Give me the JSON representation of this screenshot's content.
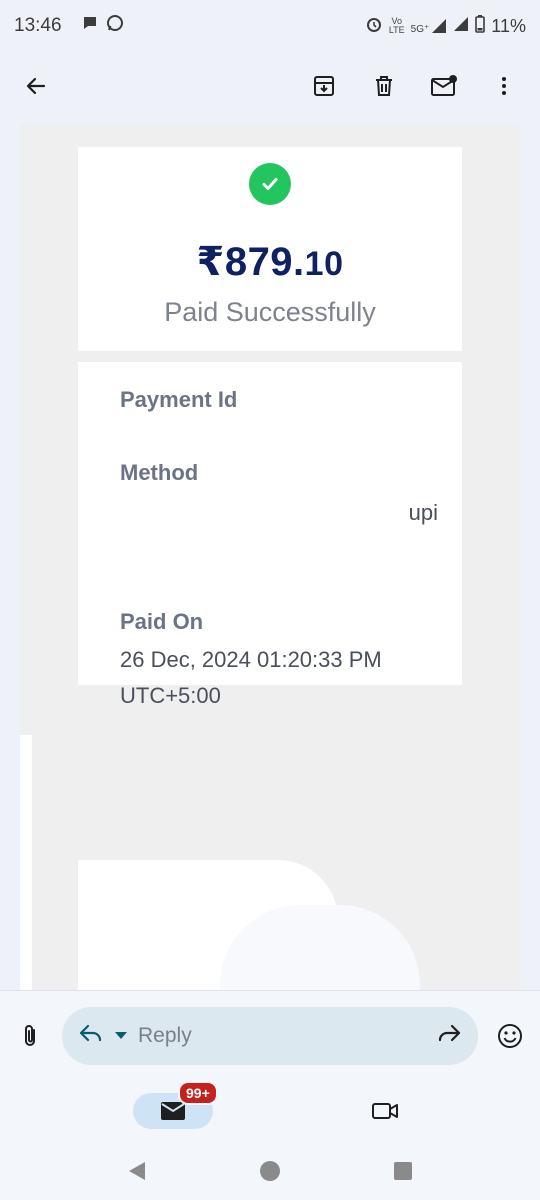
{
  "status_bar": {
    "time": "13:46",
    "network_top": "Vo",
    "network_bottom": "LTE",
    "signal_label": "5G⁺",
    "battery": "11%"
  },
  "toolbar": {
    "back_icon": "arrow-left-icon",
    "archive_icon": "archive-icon",
    "delete_icon": "trash-icon",
    "mark_unread_icon": "mail-unread-icon",
    "more_icon": "more-vertical-icon"
  },
  "receipt": {
    "amount_main": "₹879.",
    "amount_decimal": "10",
    "status": "Paid Successfully",
    "payment_id_label": "Payment Id",
    "method_label": "Method",
    "method_value": "upi",
    "paid_on_label": "Paid On",
    "paid_on_value_line1": "26 Dec, 2024 01:20:33 PM",
    "paid_on_value_line2": "UTC+5:00",
    "colors": {
      "accent": "#22c55e",
      "amount": "#0f2160"
    }
  },
  "reply_bar": {
    "placeholder": "Reply"
  },
  "bottom_nav": {
    "mail_badge": "99+"
  }
}
